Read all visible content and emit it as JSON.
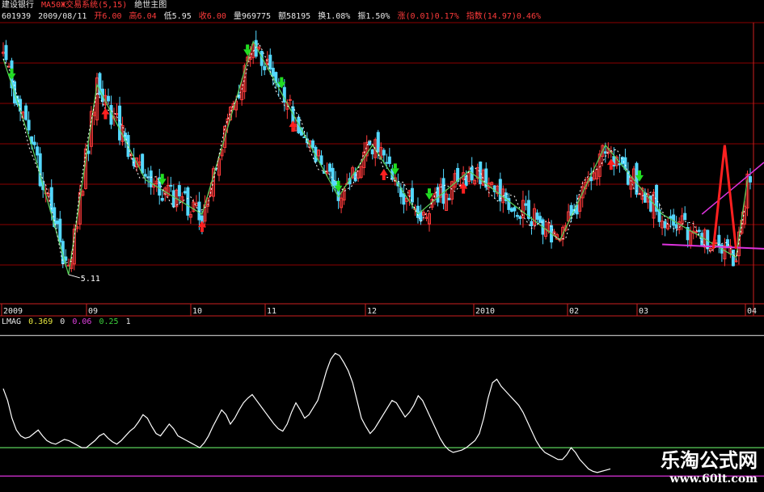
{
  "header": {
    "stock_name": "建设银行",
    "indicator": "MA50Ж交易系统(5,15)",
    "indicator_extra": "绝世主图",
    "code": "601939",
    "date": "2009/08/11",
    "open": "开6.00",
    "high": "高6.04",
    "low": "低5.95",
    "close": "收6.00",
    "volume": "量969775",
    "amount": "额58195",
    "turnover": "换1.08%",
    "amplitude": "振1.50%",
    "change": "涨(0.01)0.17%",
    "index": "指数(14.97)0.46%"
  },
  "lower_header": {
    "name": "LMAG",
    "v1": "0.369",
    "v2": "0",
    "v3": "0.06",
    "v4": "0.25",
    "v5": "1"
  },
  "colors": {
    "background": "#000000",
    "up_candle": "#ff3b3b",
    "down_candle": "#54d8ff",
    "zigzag": "#5ad25a",
    "buy_arrow": "#ff2020",
    "sell_arrow": "#22dd22",
    "grid_red": "#8b0000",
    "lower_line": "#ffffff",
    "green_line": "#5ad25a",
    "magenta_line": "#dd33dd"
  },
  "chart_data": [
    {
      "type": "candlestick",
      "title": "",
      "x_ticks": [
        "2009",
        "09",
        "10",
        "11",
        "12",
        "2010",
        "02",
        "03",
        "04"
      ],
      "annotations": [
        {
          "text": "5.11",
          "at": "low point"
        }
      ],
      "zigzag_points": [
        [
          0,
          6.4
        ],
        [
          10,
          5.4
        ],
        [
          23,
          3.9
        ],
        [
          33,
          6.1
        ],
        [
          50,
          5.0
        ],
        [
          70,
          4.6
        ],
        [
          88,
          6.6
        ],
        [
          118,
          4.8
        ],
        [
          130,
          5.4
        ],
        [
          146,
          4.6
        ],
        [
          164,
          5.1
        ],
        [
          196,
          4.3
        ],
        [
          212,
          5.4
        ],
        [
          232,
          4.6
        ],
        [
          258,
          4.1
        ],
        [
          262,
          5.0
        ]
      ],
      "candles_seed": 91,
      "y_range": [
        3.6,
        6.8
      ],
      "legend": "none",
      "grid": "horizontal"
    },
    {
      "type": "line",
      "title": "",
      "series": [
        {
          "name": "LMAG",
          "values": [
            0.8,
            0.7,
            0.55,
            0.45,
            0.4,
            0.38,
            0.39,
            0.42,
            0.45,
            0.4,
            0.36,
            0.34,
            0.33,
            0.35,
            0.37,
            0.36,
            0.34,
            0.32,
            0.3,
            0.3,
            0.33,
            0.36,
            0.4,
            0.42,
            0.38,
            0.35,
            0.33,
            0.36,
            0.4,
            0.44,
            0.47,
            0.52,
            0.58,
            0.55,
            0.48,
            0.42,
            0.4,
            0.45,
            0.5,
            0.46,
            0.4,
            0.38,
            0.36,
            0.34,
            0.32,
            0.3,
            0.34,
            0.4,
            0.48,
            0.55,
            0.62,
            0.58,
            0.5,
            0.55,
            0.62,
            0.68,
            0.72,
            0.75,
            0.7,
            0.65,
            0.6,
            0.55,
            0.5,
            0.46,
            0.44,
            0.5,
            0.6,
            0.68,
            0.62,
            0.55,
            0.58,
            0.64,
            0.7,
            0.82,
            0.95,
            1.05,
            1.1,
            1.08,
            1.02,
            0.95,
            0.85,
            0.7,
            0.55,
            0.48,
            0.42,
            0.46,
            0.52,
            0.58,
            0.64,
            0.7,
            0.68,
            0.62,
            0.56,
            0.6,
            0.66,
            0.74,
            0.7,
            0.62,
            0.54,
            0.46,
            0.38,
            0.32,
            0.28,
            0.26,
            0.27,
            0.28,
            0.3,
            0.33,
            0.36,
            0.42,
            0.55,
            0.72,
            0.85,
            0.88,
            0.82,
            0.78,
            0.74,
            0.7,
            0.66,
            0.6,
            0.52,
            0.44,
            0.36,
            0.3,
            0.26,
            0.24,
            0.22,
            0.2,
            0.2,
            0.24,
            0.3,
            0.26,
            0.2,
            0.16,
            0.12,
            0.1,
            0.09,
            0.1,
            0.11,
            0.12
          ]
        }
      ],
      "hlines": [
        {
          "value": 0.3,
          "color": "green"
        },
        {
          "value": 0.06,
          "color": "magenta"
        },
        {
          "value": 1.25,
          "color": "white"
        }
      ],
      "y_range": [
        0.0,
        1.3
      ],
      "legend": "none",
      "grid": "off"
    }
  ],
  "watermark": {
    "title": "乐淘公式网",
    "url": "www.60lt.com"
  }
}
